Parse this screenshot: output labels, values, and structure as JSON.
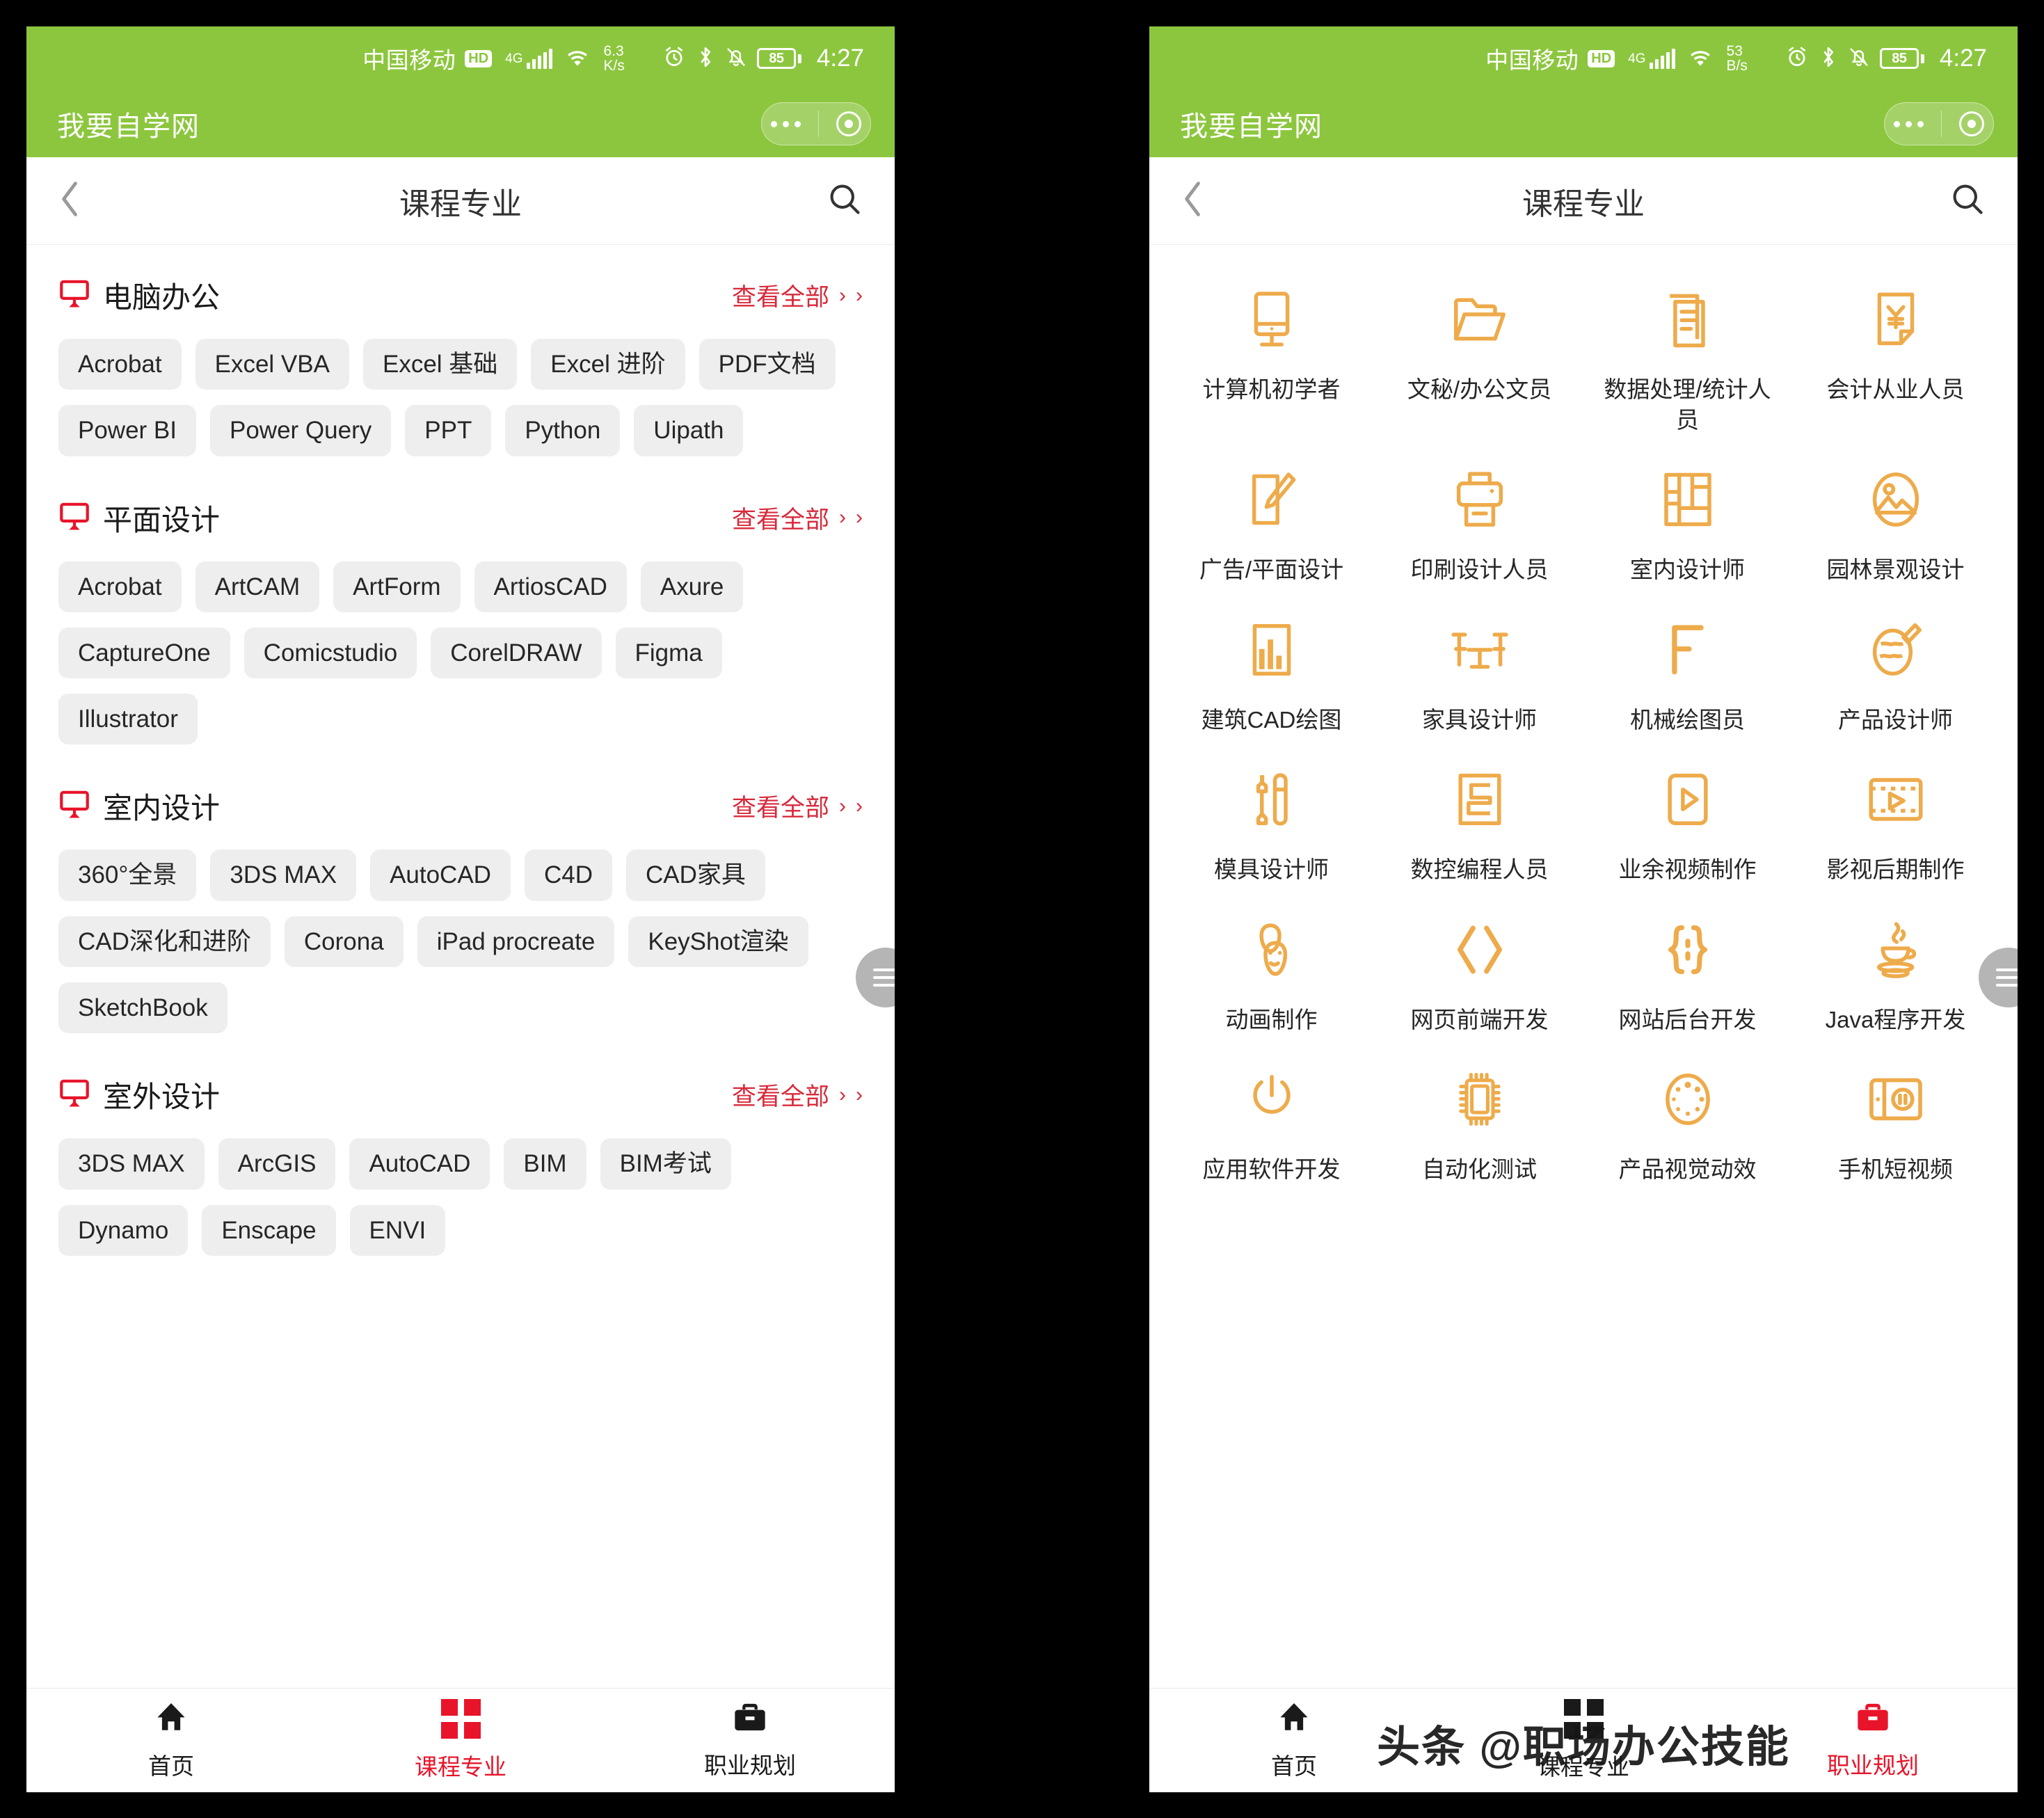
{
  "status_bar": {
    "carrier": "中国移动",
    "hd_badge": "HD",
    "network_type": "4G",
    "net_speed_value": "6.3",
    "net_speed_unit": "K/s",
    "battery_level": "85",
    "clock": "4:27"
  },
  "status_bar_right": {
    "carrier": "中国移动",
    "hd_badge": "HD",
    "network_type": "4G",
    "net_speed_value": "53",
    "net_speed_unit": "B/s",
    "battery_level": "85",
    "clock": "4:27"
  },
  "app_bar": {
    "app_name": "我要自学网"
  },
  "nav_bar": {
    "title": "课程专业"
  },
  "colors": {
    "brand_green": "#8cc63e",
    "accent_red": "#d8293b",
    "tab_active_red": "#e8142a",
    "icon_orange": "#eda council",
    "icon_orange_hex": "#eeab4b",
    "tag_bg": "#eeeeee"
  },
  "left_panel": {
    "more_label": "查看全部",
    "sections": [
      {
        "title": "电脑办公",
        "tags": [
          "Acrobat",
          "Excel VBA",
          "Excel 基础",
          "Excel 进阶",
          "PDF文档",
          "Power BI",
          "Power Query",
          "PPT",
          "Python",
          "Uipath"
        ]
      },
      {
        "title": "平面设计",
        "tags": [
          "Acrobat",
          "ArtCAM",
          "ArtForm",
          "ArtiosCAD",
          "Axure",
          "CaptureOne",
          "Comicstudio",
          "CorelDRAW",
          "Figma",
          "Illustrator"
        ]
      },
      {
        "title": "室内设计",
        "tags": [
          "360°全景",
          "3DS MAX",
          "AutoCAD",
          "C4D",
          "CAD家具",
          "CAD深化和进阶",
          "Corona",
          "iPad procreate",
          "KeyShot渲染",
          "SketchBook"
        ]
      },
      {
        "title": "室外设计",
        "tags": [
          "3DS MAX",
          "ArcGIS",
          "AutoCAD",
          "BIM",
          "BIM考试",
          "Dynamo",
          "Enscape",
          "ENVI"
        ]
      }
    ]
  },
  "right_panel": {
    "grid": [
      {
        "label": "计算机初学者",
        "icon": "monitor-icon"
      },
      {
        "label": "文秘/办公文员",
        "icon": "folder-icon"
      },
      {
        "label": "数据处理/统计人员",
        "icon": "document-list-icon"
      },
      {
        "label": "会计从业人员",
        "icon": "invoice-yuan-icon"
      },
      {
        "label": "广告/平面设计",
        "icon": "pencil-edit-icon"
      },
      {
        "label": "印刷设计人员",
        "icon": "printer-icon"
      },
      {
        "label": "室内设计师",
        "icon": "floorplan-icon"
      },
      {
        "label": "园林景观设计",
        "icon": "landscape-icon"
      },
      {
        "label": "建筑CAD绘图",
        "icon": "building-chart-icon"
      },
      {
        "label": "家具设计师",
        "icon": "table-chairs-icon"
      },
      {
        "label": "机械绘图员",
        "icon": "angle-ruler-icon"
      },
      {
        "label": "产品设计师",
        "icon": "product-sketch-icon"
      },
      {
        "label": "模具设计师",
        "icon": "wrench-screwdriver-icon"
      },
      {
        "label": "数控编程人员",
        "icon": "cnc-path-icon"
      },
      {
        "label": "业余视频制作",
        "icon": "play-rect-icon"
      },
      {
        "label": "影视后期制作",
        "icon": "film-play-icon"
      },
      {
        "label": "动画制作",
        "icon": "masks-icon"
      },
      {
        "label": "网页前端开发",
        "icon": "code-brackets-icon"
      },
      {
        "label": "网站后台开发",
        "icon": "curly-braces-icon"
      },
      {
        "label": "Java程序开发",
        "icon": "java-coffee-icon"
      },
      {
        "label": "应用软件开发",
        "icon": "power-mouse-icon"
      },
      {
        "label": "自动化测试",
        "icon": "chip-icon"
      },
      {
        "label": "产品视觉动效",
        "icon": "motion-circle-icon"
      },
      {
        "label": "手机短视频",
        "icon": "phone-video-icon"
      }
    ]
  },
  "tab_bar": {
    "tabs": [
      {
        "label": "首页",
        "icon": "home-icon",
        "active": false
      },
      {
        "label": "课程专业",
        "icon": "grid-icon",
        "active": true
      },
      {
        "label": "职业规划",
        "icon": "briefcase-icon",
        "active": false
      }
    ]
  },
  "tab_bar_right": {
    "tabs": [
      {
        "label": "首页",
        "icon": "home-icon",
        "active": false
      },
      {
        "label": "课程专业",
        "icon": "grid-icon",
        "active": false
      },
      {
        "label": "职业规划",
        "icon": "briefcase-icon",
        "active": true
      }
    ]
  },
  "watermark": {
    "text": "头条 @职场办公技能"
  }
}
